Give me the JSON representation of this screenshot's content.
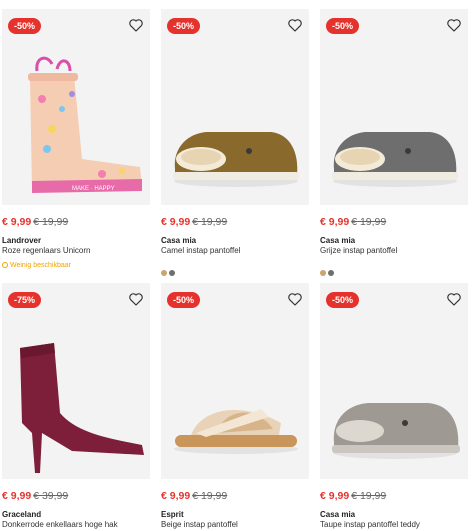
{
  "products": [
    {
      "badge": "-50%",
      "price_new": "€ 9,99",
      "price_old": "€ 19,99",
      "brand": "Landrover",
      "name": "Roze regenlaars Unicorn",
      "availability": "Weinig beschikbaar",
      "swatches": [],
      "icon": "rain-boot-image"
    },
    {
      "badge": "-50%",
      "price_new": "€ 9,99",
      "price_old": "€ 19,99",
      "brand": "Casa mia",
      "name": "Camel instap pantoffel",
      "availability": "",
      "swatches": [
        "#c9a66b",
        "#6f6f6f"
      ],
      "icon": "camel-slipper-image"
    },
    {
      "badge": "-50%",
      "price_new": "€ 9,99",
      "price_old": "€ 19,99",
      "brand": "Casa mia",
      "name": "Grijze instap pantoffel",
      "availability": "",
      "swatches": [
        "#c9a66b",
        "#6f6f6f"
      ],
      "icon": "grey-slipper-image"
    },
    {
      "badge": "-75%",
      "price_new": "€ 9,99",
      "price_old": "€ 39,99",
      "brand": "Graceland",
      "name": "Donkerrode enkellaars hoge hak",
      "availability": "",
      "swatches": [],
      "icon": "ankle-boot-image"
    },
    {
      "badge": "-50%",
      "price_new": "€ 9,99",
      "price_old": "€ 19,99",
      "brand": "Esprit",
      "name": "Beige instap pantoffel",
      "availability": "",
      "swatches": [],
      "icon": "beige-slipper-image"
    },
    {
      "badge": "-50%",
      "price_new": "€ 9,99",
      "price_old": "€ 19,99",
      "brand": "Casa mia",
      "name": "Taupe instap pantoffel teddy",
      "availability": "",
      "swatches": [],
      "icon": "taupe-slipper-image"
    }
  ],
  "colors": {
    "discount_red": "#e5322d",
    "low_stock": "#f0a400",
    "image_bg": "#f3f3f3"
  }
}
